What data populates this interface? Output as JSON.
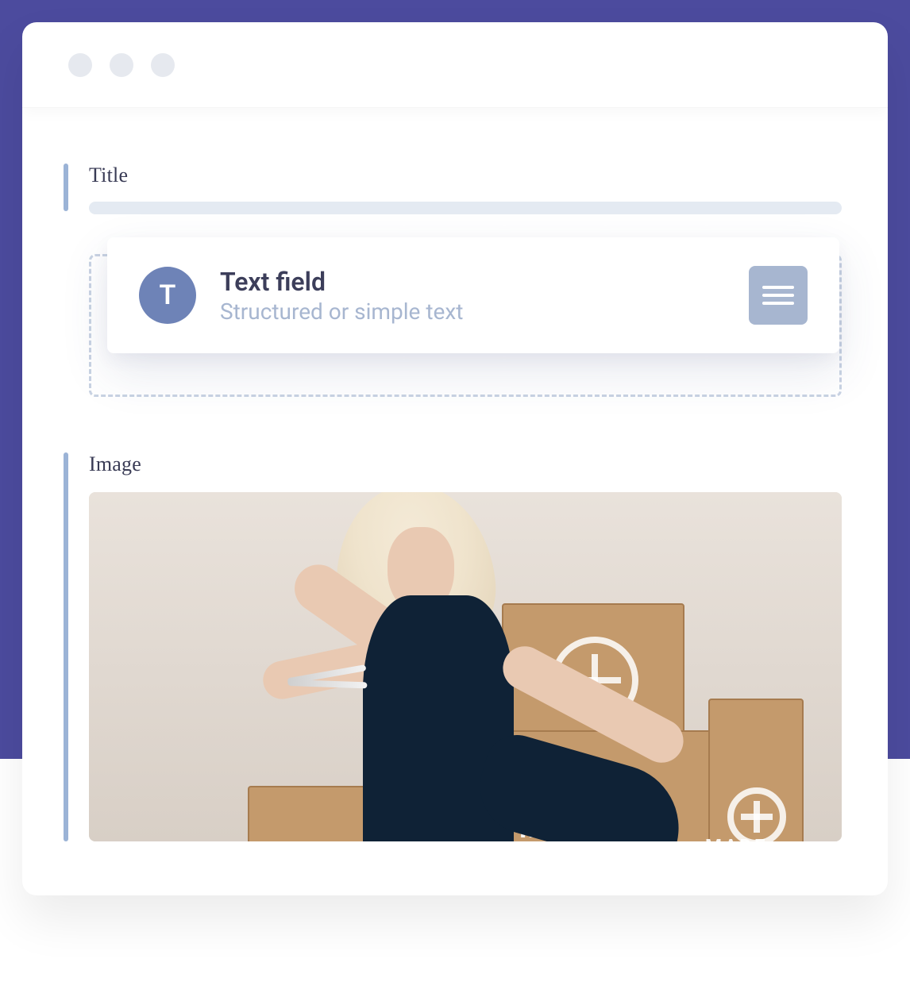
{
  "fields": {
    "title_label": "Title",
    "image_label": "Image"
  },
  "card": {
    "badge_letter": "T",
    "title": "Text field",
    "subtitle": "Structured or simple text"
  },
  "image": {
    "brand_text_left": "MADE",
    "brand_text_right": "MADE"
  }
}
